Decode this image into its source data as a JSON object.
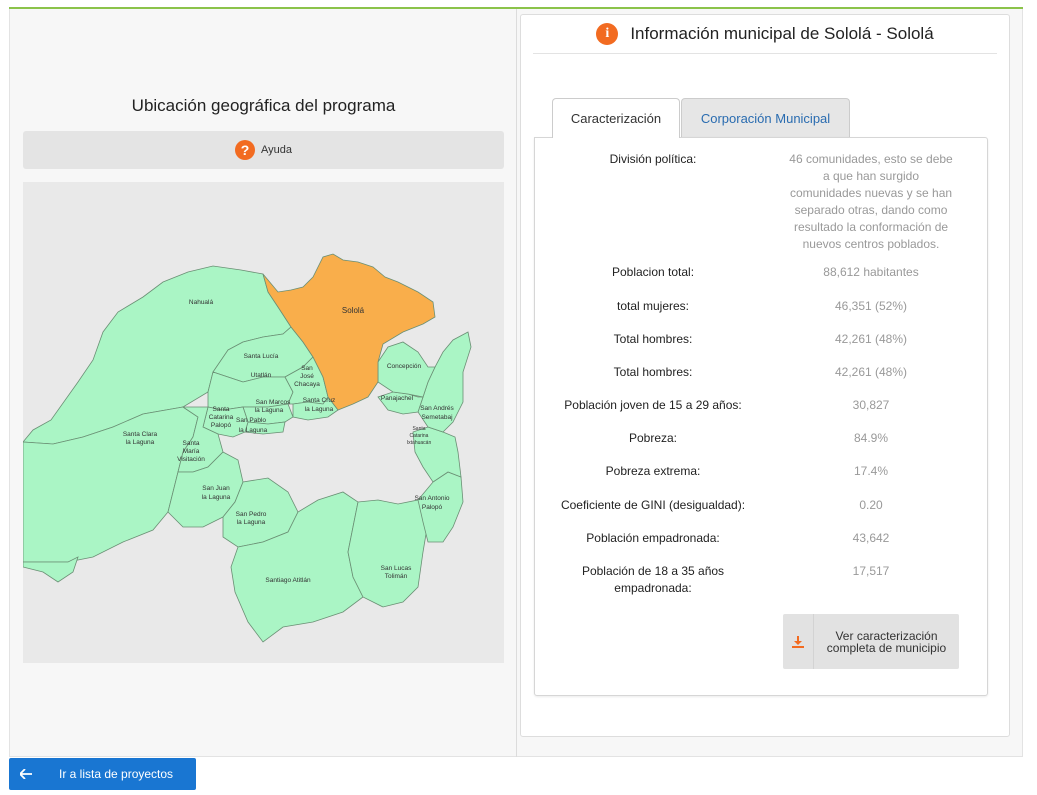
{
  "map_panel": {
    "title": "Ubicación geográfica del programa",
    "help_label": "Ayuda",
    "municipalities": [
      "Nahualá",
      "Sololá",
      "Santa Lucía",
      "Utatlán",
      "San José Chacaya",
      "Concepción",
      "Panajachel",
      "San Andrés Semetabaj",
      "Santa Catarina Palopó",
      "San Marcos la Laguna",
      "San Pablo la Laguna",
      "Santa Cruz la Laguna",
      "Santa Clara la Laguna",
      "Santa María Visitación",
      "San Juan la Laguna",
      "San Pedro la Laguna",
      "Santiago Atitlán",
      "San Lucas Tolimán",
      "San Antonio Palopó",
      "Santa Catarina Ixtahuacán"
    ],
    "highlight_color": "#f9ae4b",
    "region_color": "#aaf5c5"
  },
  "info_card": {
    "title": "Información municipal de Sololá - Sololá",
    "tabs": [
      {
        "label": "Caracterización",
        "active": true
      },
      {
        "label": "Corporación Municipal",
        "active": false
      }
    ],
    "rows": [
      {
        "label": "División política:",
        "value": "46 comunidades, esto se debe a que han surgido comunidades nuevas y se han separado otras, dando como resultado la conformación de nuevos centros poblados."
      },
      {
        "label": "Poblacion total:",
        "value": "88,612 habitantes"
      },
      {
        "label": "total mujeres:",
        "value": "46,351 (52%)"
      },
      {
        "label": "Total hombres:",
        "value": "42,261 (48%)"
      },
      {
        "label": "Total hombres:",
        "value": "42,261 (48%)"
      },
      {
        "label": "Población joven de 15 a 29 años:",
        "value": "30,827"
      },
      {
        "label": "Pobreza:",
        "value": "84.9%"
      },
      {
        "label": "Pobreza extrema:",
        "value": "17.4%"
      },
      {
        "label": "Coeficiente de GINI (desigualdad):",
        "value": "0.20"
      },
      {
        "label": "Población empadronada:",
        "value": "43,642"
      },
      {
        "label": "Población de 18 a 35 años empadronada:",
        "value": "17,517"
      }
    ],
    "download_button": "Ver caracterización completa de municipio"
  },
  "footer": {
    "back_button": "Ir a lista de proyectos"
  },
  "colors": {
    "accent_green": "#8bc34a",
    "icon_orange": "#f26b21",
    "primary_blue": "#1976d2"
  }
}
